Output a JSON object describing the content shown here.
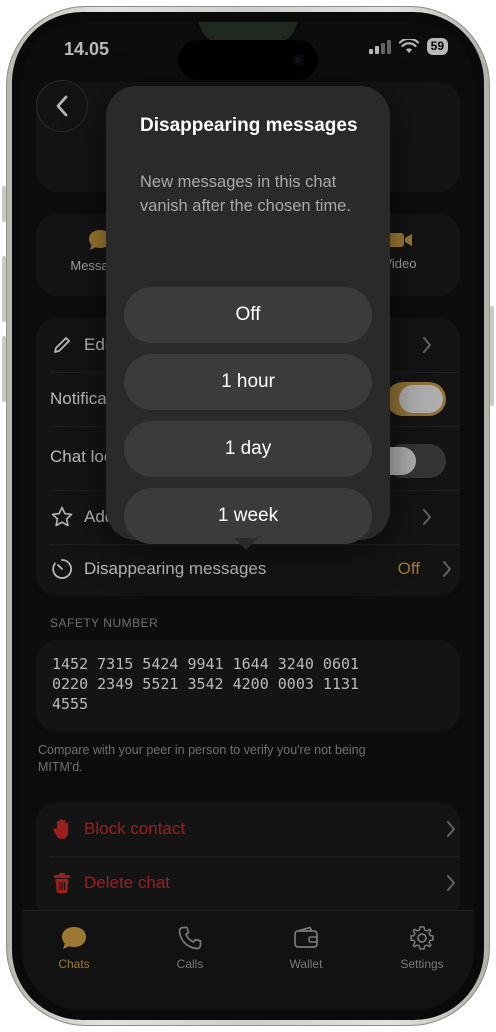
{
  "status_bar": {
    "time": "14.05",
    "battery": "59"
  },
  "quick_actions": {
    "message_label": "Messages",
    "video_label": "Video"
  },
  "settings": {
    "edit_label": "Edit nickname",
    "notifications_label": "Notifications",
    "chat_lock_label": "Chat lock",
    "favorite_label": "Add to favorites",
    "disappearing_label": "Disappearing messages",
    "disappearing_value": "Off"
  },
  "safety": {
    "section_label": "SAFETY NUMBER",
    "number": "1452 7315 5424 9941 1644 3240 0601\n0220 2349 5521 3542 4200 0003 1131\n4555",
    "caption": "Compare with your peer in person to verify you're not being MITM'd."
  },
  "danger_actions": {
    "block_label": "Block contact",
    "delete_label": "Delete chat"
  },
  "tabs": [
    {
      "label": "Chats",
      "icon": "chat-bubble-icon"
    },
    {
      "label": "Calls",
      "icon": "phone-icon"
    },
    {
      "label": "Wallet",
      "icon": "wallet-icon"
    },
    {
      "label": "Settings",
      "icon": "gear-icon"
    }
  ],
  "popover": {
    "title": "Disappearing messages",
    "description": "New messages in this chat vanish after the chosen time.",
    "options": [
      "Off",
      "1 hour",
      "1 day",
      "1 week"
    ]
  },
  "colors": {
    "accent": "#d8a847",
    "danger": "#d62b2b",
    "toggle_on": "#c9a04c",
    "background": "#121212",
    "card": "#1d1d1d"
  }
}
